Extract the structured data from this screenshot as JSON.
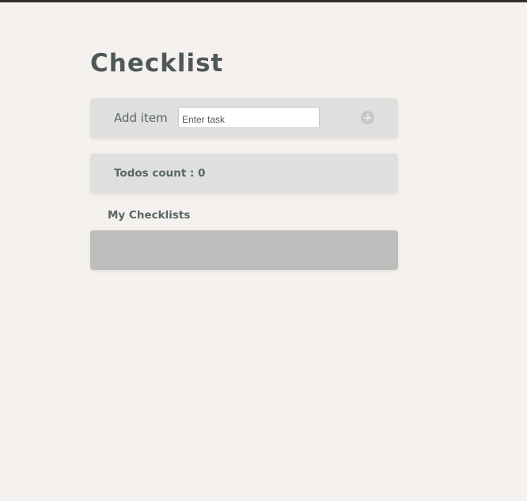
{
  "header": {
    "title": "Checklist"
  },
  "add_item": {
    "label": "Add item",
    "input_placeholder": "Enter task",
    "input_value": "",
    "add_button_icon": "plus-circle-icon"
  },
  "todos": {
    "count_text": "Todos count : 0"
  },
  "checklists": {
    "heading": "My Checklists",
    "items": []
  },
  "colors": {
    "background": "#f5f1ee",
    "card": "#dfe0de",
    "list_container": "#bdbdbb",
    "text": "#4f5859"
  }
}
